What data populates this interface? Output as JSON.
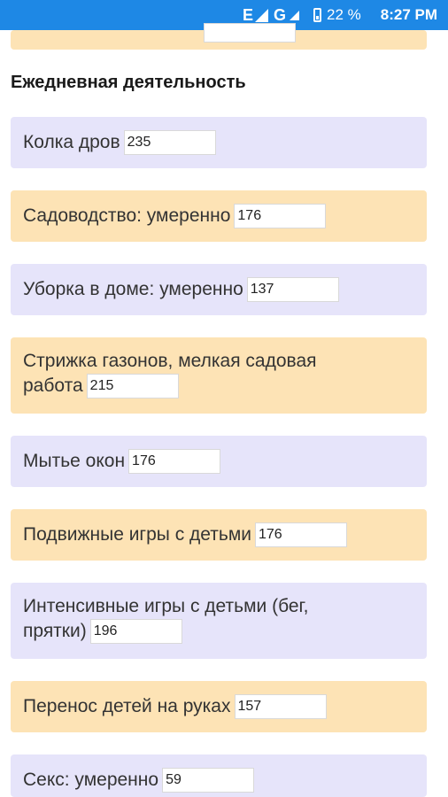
{
  "status_bar": {
    "network": "E",
    "network2": "G",
    "battery": "22 %",
    "time": "8:27 PM"
  },
  "section": {
    "title": "Ежедневная деятельность"
  },
  "activities": [
    {
      "label": "Колка дров",
      "value": "235"
    },
    {
      "label": "Садоводство: умеренно",
      "value": "176"
    },
    {
      "label": "Уборка в доме: умеренно",
      "value": "137"
    },
    {
      "label": "Стрижка газонов, мелкая садовая работа",
      "label_line1": "Стрижка газонов, мелкая садовая",
      "label_line2": "работа",
      "value": "215"
    },
    {
      "label": "Мытье окон",
      "value": "176"
    },
    {
      "label": "Подвижные игры с детьми",
      "value": "176"
    },
    {
      "label": "Интенсивные игры с детьми (бег, прятки)",
      "label_line1": "Интенсивные игры с детьми (бег,",
      "label_line2": "прятки)",
      "value": "196"
    },
    {
      "label": "Перенос детей на руках",
      "value": "157"
    },
    {
      "label": "Секс: умеренно",
      "value": "59"
    }
  ]
}
